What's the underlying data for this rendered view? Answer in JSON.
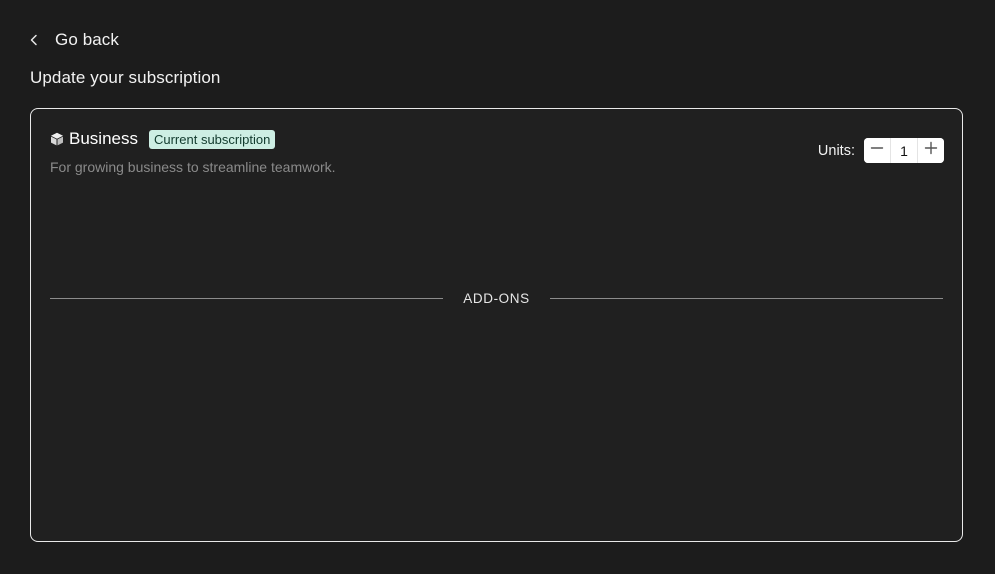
{
  "nav": {
    "back_label": "Go back",
    "back_icon": "chevron-left-icon"
  },
  "page": {
    "title": "Update your subscription"
  },
  "plan": {
    "icon": "box-icon",
    "name": "Business",
    "badge": "Current subscription",
    "description": "For growing business to streamline teamwork."
  },
  "units": {
    "label": "Units:",
    "value": "1",
    "decrement_icon": "minus-icon",
    "increment_icon": "plus-icon"
  },
  "addons": {
    "divider_label": "ADD-ONS"
  },
  "colors": {
    "background": "#1c1c1c",
    "card_background": "#202020",
    "card_border": "#e9e9e9",
    "badge_background": "#cdeee3",
    "badge_text": "#123b2e",
    "muted_text": "#8a8a8a"
  }
}
